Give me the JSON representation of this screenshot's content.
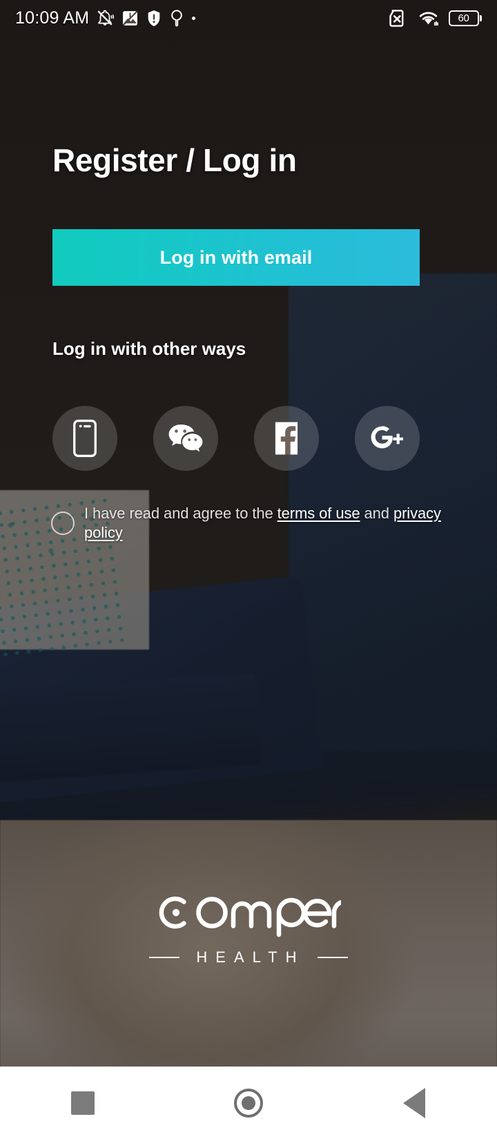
{
  "status_bar": {
    "time": "10:09 AM",
    "left_icons": [
      "mute-bell-icon",
      "broken-image-icon",
      "shield-exclamation-icon",
      "location-pin-icon",
      "dot-icon"
    ],
    "right_icons": [
      "sim-x-icon",
      "wifi-icon",
      "battery-icon"
    ],
    "battery_level": "60"
  },
  "page": {
    "title": "Register / Log in"
  },
  "primary_action": {
    "label": "Log in with email",
    "gradient_start": "#11cbbe",
    "gradient_end": "#2bbcdb"
  },
  "alternate_logins": {
    "heading": "Log in with other ways",
    "options": [
      {
        "name": "phone",
        "icon": "phone-icon",
        "label": "Log in with phone"
      },
      {
        "name": "wechat",
        "icon": "wechat-icon",
        "label": "Log in with WeChat"
      },
      {
        "name": "facebook",
        "icon": "facebook-icon",
        "label": "Log in with Facebook"
      },
      {
        "name": "google",
        "icon": "google-plus-icon",
        "label": "Log in with Google Plus"
      }
    ]
  },
  "consent": {
    "checked": false,
    "text_before": "I have read and agree to the ",
    "terms_link": "terms of use",
    "text_between": " and ",
    "privacy_link": "privacy policy"
  },
  "brand": {
    "name": "comper",
    "tagline": "HEALTH"
  },
  "navigation_bar": {
    "recents": "recents-square-icon",
    "home": "home-circle-icon",
    "back": "back-triangle-icon"
  }
}
